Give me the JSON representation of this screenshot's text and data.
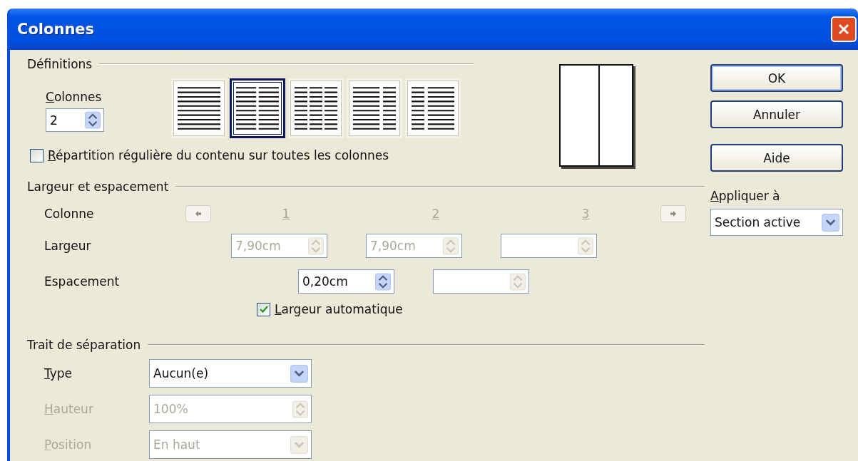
{
  "window": {
    "title": "Colonnes"
  },
  "definitions": {
    "title": "Définitions",
    "columns_label": "Colonnes",
    "columns_value": "2",
    "layouts": [
      {
        "kind": "one",
        "selected": false
      },
      {
        "kind": "two",
        "selected": true
      },
      {
        "kind": "three",
        "selected": false
      },
      {
        "kind": "wide-left",
        "selected": false
      },
      {
        "kind": "wide-right",
        "selected": false
      }
    ],
    "even_distribution": {
      "label": "Répartition régulière du contenu sur toutes les colonnes",
      "checked": false
    }
  },
  "buttons": [
    {
      "label": "OK",
      "default": true
    },
    {
      "label": "Annuler",
      "default": false
    },
    {
      "label": "Aide",
      "default": false
    }
  ],
  "apply_to": {
    "label": "Appliquer à",
    "value": "Section active"
  },
  "width_spacing": {
    "title": "Largeur et espacement",
    "column_label": "Colonne",
    "column_numbers": [
      "1",
      "2",
      "3"
    ],
    "width_label": "Largeur",
    "widths": [
      {
        "value": "7,90cm",
        "disabled": true
      },
      {
        "value": "7,90cm",
        "disabled": true
      },
      {
        "disabled": true
      }
    ],
    "spacing_label": "Espacement",
    "spacings": [
      {
        "value": "0,20cm",
        "disabled": false
      },
      {
        "disabled": true
      }
    ],
    "auto_width": {
      "label": "Largeur automatique",
      "checked": true
    }
  },
  "separator": {
    "title": "Trait de séparation",
    "fields": [
      {
        "kind": "dropdown",
        "label": "Type",
        "value": "Aucun(e)",
        "disabled": false
      },
      {
        "kind": "spin",
        "label": "Hauteur",
        "value": "100%",
        "disabled": true
      },
      {
        "kind": "dropdown",
        "label": "Position",
        "value": "En haut",
        "disabled": true
      }
    ]
  }
}
